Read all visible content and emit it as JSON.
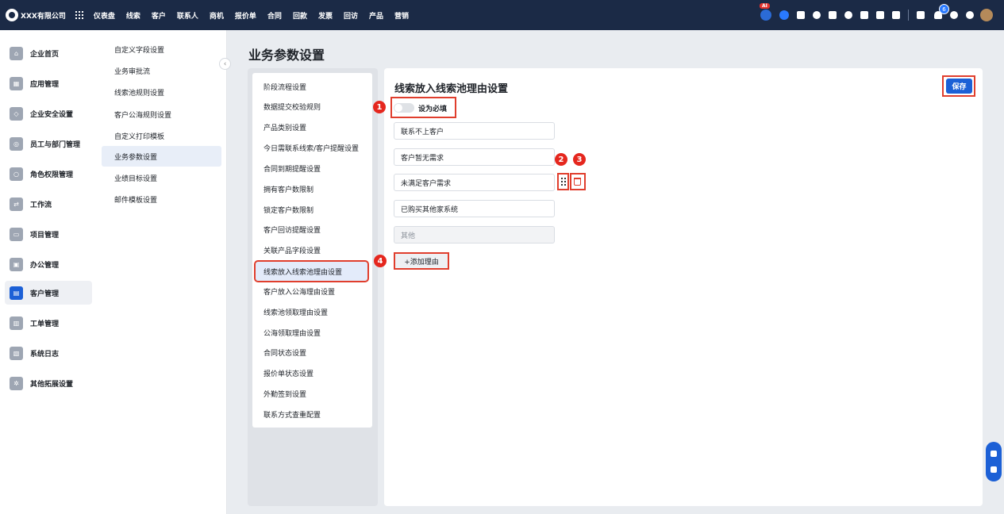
{
  "topbar": {
    "brand": "XXX有限公司",
    "nav": [
      "仪表盘",
      "线索",
      "客户",
      "联系人",
      "商机",
      "报价单",
      "合同",
      "回款",
      "发票",
      "回访",
      "产品",
      "营销"
    ],
    "ai_badge": "AI",
    "notification_count": "6",
    "icons": [
      "ai-assistant-icon",
      "bot-icon",
      "chat-icon",
      "globe-icon",
      "mail-icon",
      "user-icon",
      "document-icon",
      "phone-icon",
      "calendar-icon",
      "report-icon",
      "bell-icon",
      "help-icon",
      "settings-icon",
      "avatar"
    ]
  },
  "sidebar": {
    "items": [
      {
        "label": "企业首页",
        "icon": "home-icon"
      },
      {
        "label": "应用管理",
        "icon": "apps-icon"
      },
      {
        "label": "企业安全设置",
        "icon": "shield-icon"
      },
      {
        "label": "员工与部门管理",
        "icon": "team-icon"
      },
      {
        "label": "角色权限管理",
        "icon": "role-icon"
      },
      {
        "label": "工作流",
        "icon": "workflow-icon"
      },
      {
        "label": "项目管理",
        "icon": "project-icon"
      },
      {
        "label": "办公管理",
        "icon": "office-icon"
      },
      {
        "label": "客户管理",
        "icon": "customer-icon"
      },
      {
        "label": "工单管理",
        "icon": "ticket-icon"
      },
      {
        "label": "系统日志",
        "icon": "log-icon"
      },
      {
        "label": "其他拓展设置",
        "icon": "extension-icon"
      }
    ],
    "active": "客户管理"
  },
  "subnav": {
    "items": [
      "自定义字段设置",
      "业务审批流",
      "线索池规则设置",
      "客户公海规则设置",
      "自定义打印模板",
      "业务参数设置",
      "业绩目标设置",
      "邮件模板设置"
    ],
    "active": "业务参数设置"
  },
  "page": {
    "title": "业务参数设置"
  },
  "settings_menu": {
    "items": [
      "阶段流程设置",
      "数据提交校验规则",
      "产品类别设置",
      "今日需联系线索/客户提醒设置",
      "合同到期提醒设置",
      "拥有客户数限制",
      "锁定客户数限制",
      "客户回访提醒设置",
      "关联产品字段设置",
      "线索放入线索池理由设置",
      "客户放入公海理由设置",
      "线索池领取理由设置",
      "公海领取理由设置",
      "合同状态设置",
      "报价单状态设置",
      "外勤签到设置",
      "联系方式查重配置"
    ],
    "active": "线索放入线索池理由设置"
  },
  "content": {
    "title": "线索放入线索池理由设置",
    "save_label": "保存",
    "required_toggle_label": "设为必填",
    "required_on": false,
    "reasons": [
      "联系不上客户",
      "客户暂无需求",
      "未满足客户需求",
      "已购买其他家系统",
      "其他"
    ],
    "add_reason_label": "+添加理由"
  },
  "markers": [
    "1",
    "2",
    "3",
    "4"
  ],
  "colors": {
    "primary": "#1c60d6",
    "highlight": "#e03e2d",
    "topbar": "#1b2a46"
  }
}
